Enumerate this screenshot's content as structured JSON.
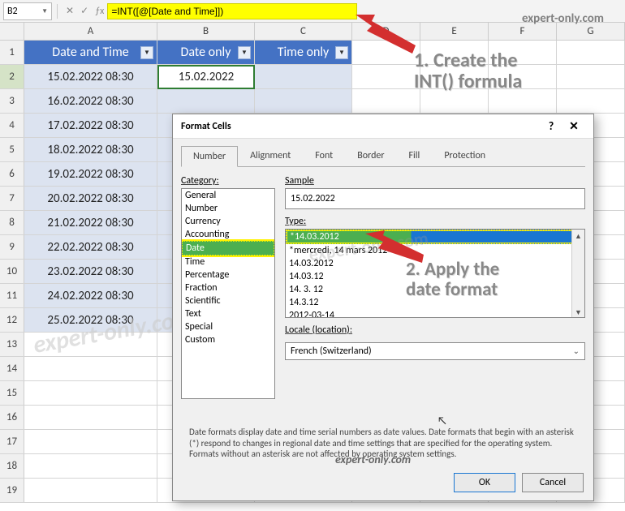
{
  "watermark": "expert-only.com",
  "name_box": "B2",
  "formula": "=INT([@[Date and Time]])",
  "columns": [
    "A",
    "B",
    "C",
    "D",
    "E",
    "F",
    "G"
  ],
  "headers": {
    "a": "Date and Time",
    "b": "Date only",
    "c": "Time only"
  },
  "rows": [
    {
      "n": "1",
      "a": "",
      "b": "",
      "c": ""
    },
    {
      "n": "2",
      "a": "15.02.2022 08:30",
      "b": "15.02.2022",
      "c": ""
    },
    {
      "n": "3",
      "a": "16.02.2022 08:30",
      "b": "",
      "c": ""
    },
    {
      "n": "4",
      "a": "17.02.2022 08:30",
      "b": "",
      "c": ""
    },
    {
      "n": "5",
      "a": "18.02.2022 08:30",
      "b": "",
      "c": ""
    },
    {
      "n": "6",
      "a": "19.02.2022 08:30",
      "b": "",
      "c": ""
    },
    {
      "n": "7",
      "a": "20.02.2022 08:30",
      "b": "",
      "c": ""
    },
    {
      "n": "8",
      "a": "21.02.2022 08:30",
      "b": "",
      "c": ""
    },
    {
      "n": "9",
      "a": "22.02.2022 08:30",
      "b": "",
      "c": ""
    },
    {
      "n": "10",
      "a": "23.02.2022 08:30",
      "b": "",
      "c": ""
    },
    {
      "n": "11",
      "a": "24.02.2022 08:30",
      "b": "",
      "c": ""
    },
    {
      "n": "12",
      "a": "25.02.2022 08:30",
      "b": "",
      "c": ""
    },
    {
      "n": "13",
      "a": "",
      "b": "",
      "c": ""
    },
    {
      "n": "14",
      "a": "",
      "b": "",
      "c": ""
    },
    {
      "n": "15",
      "a": "",
      "b": "",
      "c": ""
    },
    {
      "n": "16",
      "a": "",
      "b": "",
      "c": ""
    },
    {
      "n": "17",
      "a": "",
      "b": "",
      "c": ""
    },
    {
      "n": "18",
      "a": "",
      "b": "",
      "c": ""
    },
    {
      "n": "19",
      "a": "",
      "b": "",
      "c": ""
    }
  ],
  "anno1_l1": "1. Create the",
  "anno1_l2": "INT() formula",
  "anno2_l1": "2. Apply the",
  "anno2_l2": "date format",
  "dialog": {
    "title": "Format Cells",
    "tabs": [
      "Number",
      "Alignment",
      "Font",
      "Border",
      "Fill",
      "Protection"
    ],
    "category_label": "Category:",
    "categories": [
      "General",
      "Number",
      "Currency",
      "Accounting",
      "Date",
      "Time",
      "Percentage",
      "Fraction",
      "Scientific",
      "Text",
      "Special",
      "Custom"
    ],
    "category_selected": "Date",
    "sample_label": "Sample",
    "sample_value": "15.02.2022",
    "type_label": "Type:",
    "types": [
      "*14.03.2012",
      "*mercredi, 14 mars 2012",
      "14.03.2012",
      "14.03.12",
      "14. 3. 12",
      "14.3.12",
      "2012-03-14"
    ],
    "type_selected": "*14.03.2012",
    "locale_label": "Locale (location):",
    "locale_value": "French (Switzerland)",
    "desc": "Date formats display date and time serial numbers as date values.  Date formats that begin with an asterisk (*) respond to changes in regional date and time settings that are specified for the operating system. Formats without an asterisk are not affected by operating system settings.",
    "ok": "OK",
    "cancel": "Cancel"
  }
}
